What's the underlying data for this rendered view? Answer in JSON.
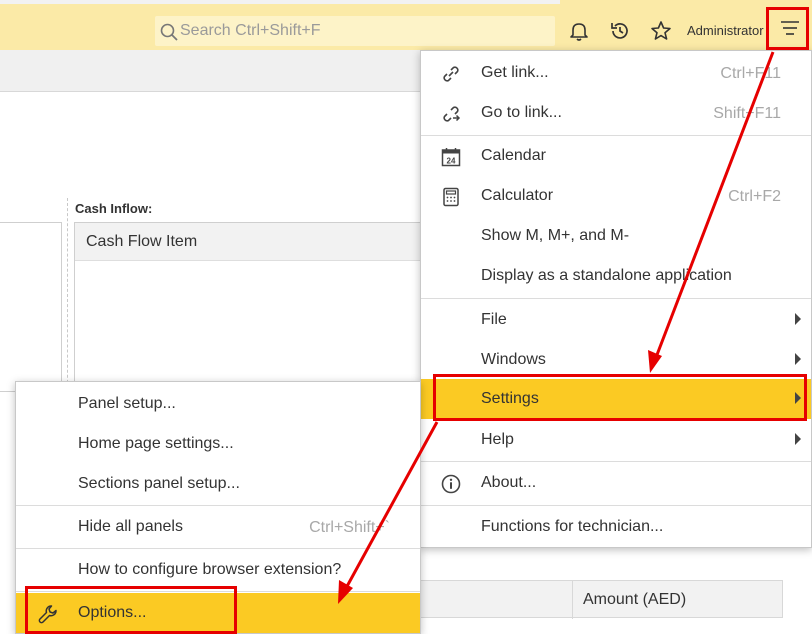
{
  "header": {
    "search_placeholder": "Search Ctrl+Shift+F",
    "user_name": "Administrator",
    "icons": [
      "search-icon",
      "bell-icon",
      "history-icon",
      "star-icon",
      "menu-icon"
    ]
  },
  "background": {
    "cash_inflow_label": "Cash Inflow:",
    "cash_inflow_column": "Cash Flow Item",
    "table_column_amount": "Amount (AED)"
  },
  "main_menu": {
    "items": [
      {
        "label": "Get link...",
        "shortcut": "Ctrl+F11",
        "icon": "link-icon"
      },
      {
        "label": "Go to link...",
        "shortcut": "Shift+F11",
        "icon": "go-to-link-icon"
      },
      {
        "label": "Calendar",
        "shortcut": "",
        "icon": "calendar-icon"
      },
      {
        "label": "Calculator",
        "shortcut": "Ctrl+F2",
        "icon": "calculator-icon"
      },
      {
        "label": "Show M, M+, and M-",
        "shortcut": ""
      },
      {
        "label": "Display as a standalone application",
        "shortcut": ""
      },
      {
        "label": "File",
        "submenu": true
      },
      {
        "label": "Windows",
        "submenu": true
      },
      {
        "label": "Settings",
        "submenu": true,
        "highlighted": true
      },
      {
        "label": "Help",
        "submenu": true
      },
      {
        "label": "About...",
        "icon": "info-icon"
      },
      {
        "label": "Functions for technician..."
      }
    ],
    "calendar_icon_day": "24"
  },
  "settings_submenu": {
    "items": [
      {
        "label": "Panel setup..."
      },
      {
        "label": "Home page settings..."
      },
      {
        "label": "Sections panel setup..."
      },
      {
        "label": "Hide all panels",
        "shortcut": "Ctrl+Shift+`"
      },
      {
        "label": "How to configure browser extension?"
      },
      {
        "label": "Options...",
        "icon": "wrench-icon",
        "highlighted": true
      }
    ]
  },
  "colors": {
    "header_bg": "#fbeaa7",
    "highlight": "#fbca23",
    "annotation": "#e60000"
  }
}
